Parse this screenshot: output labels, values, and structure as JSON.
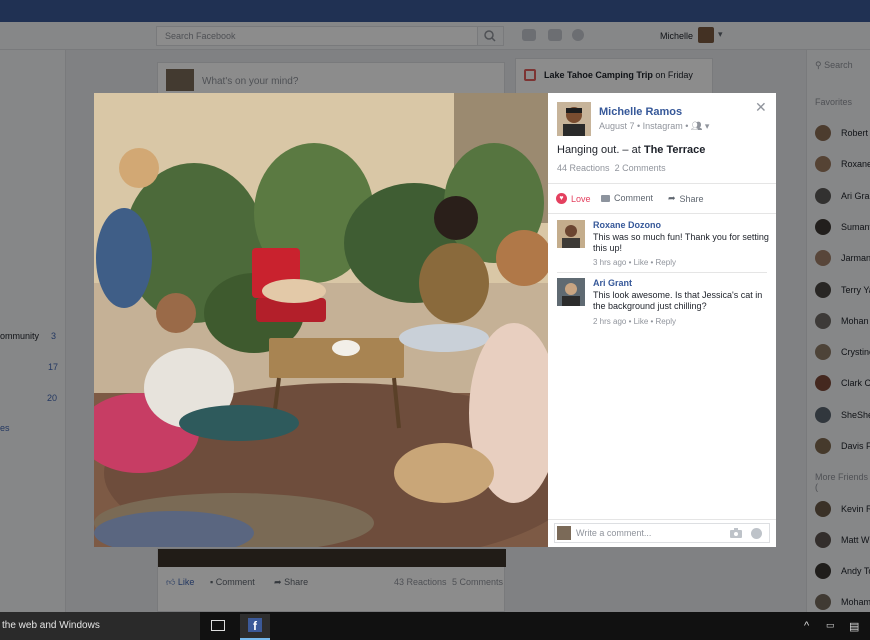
{
  "header": {
    "search_placeholder": "Search Facebook",
    "user_name": "Michelle"
  },
  "left_sidebar": {
    "items": [
      {
        "label": "ommunity",
        "count": "3"
      },
      {
        "label": "",
        "count": "17"
      },
      {
        "label": "",
        "count": "20"
      }
    ],
    "link": "es"
  },
  "composer": {
    "placeholder": "What's on your mind?"
  },
  "event": {
    "title": "Lake Tahoe Camping Trip",
    "when": " on Friday"
  },
  "post": {
    "like_label": "Like",
    "comment_label": "Comment",
    "share_label": "Share",
    "reactions": "43 Reactions",
    "comments": "5 Comments"
  },
  "right_sidebar": {
    "search_label": "Search",
    "favorites_heading": "Favorites",
    "more_friends_heading": "More Friends (",
    "favorites": [
      "Robert L",
      "Roxane",
      "Ari Gran",
      "Sumantr",
      "Jarman S",
      "Terry Ya",
      "Mohan G",
      "Crystine",
      "Clark Co",
      "SheShe",
      "Davis Fir"
    ],
    "more_friends": [
      "Kevin Ri",
      "Matt Wis",
      "Andy To",
      "Mohamm"
    ]
  },
  "theater": {
    "author": "Michelle Ramos",
    "meta": "August 7 • Instagram • ",
    "caption_prefix": "Hanging out. – at ",
    "caption_place": "The Terrace",
    "reactions": "44 Reactions",
    "comment_count": "2 Comments",
    "love_label": "Love",
    "comment_label": "Comment",
    "share_label": "Share",
    "comments": [
      {
        "author": "Roxane Dozono",
        "text": "This was so much fun! Thank you for setting this up!",
        "meta": "3 hrs ago • Like • Reply"
      },
      {
        "author": "Ari Grant",
        "text": "This look awesome. Is that Jessica's cat in the background just chilling?",
        "meta": "2 hrs ago • Like • Reply"
      }
    ],
    "write_placeholder": "Write a comment..."
  },
  "taskbar": {
    "search_text": "the web and Windows"
  }
}
